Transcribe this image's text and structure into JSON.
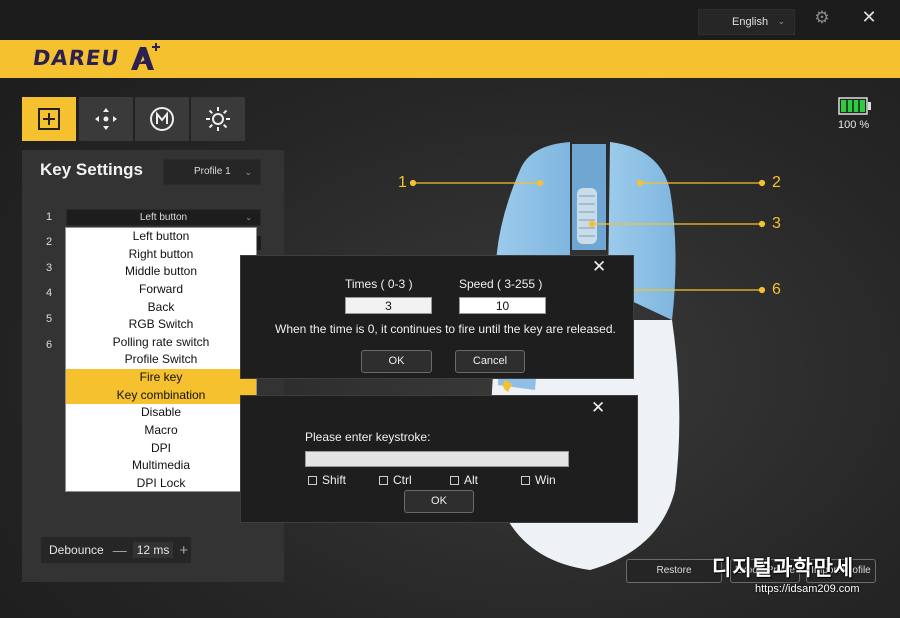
{
  "window": {
    "language": "English"
  },
  "brand": {
    "name": "DAREU",
    "accent": "#f5c12e",
    "dark": "#2a2152"
  },
  "modes": [
    {
      "icon": "plus-square-icon",
      "active": true
    },
    {
      "icon": "move-arrows-icon",
      "active": false
    },
    {
      "icon": "macro-m-icon",
      "active": false
    },
    {
      "icon": "brightness-icon",
      "active": false
    }
  ],
  "battery": {
    "level": 1.0,
    "label": "100 %"
  },
  "key_settings": {
    "title": "Key Settings",
    "profile": "Profile 1",
    "key_numbers": [
      "1",
      "2",
      "3",
      "4",
      "5",
      "6"
    ],
    "key1_value": "Left button",
    "dropdown_options": [
      "Left button",
      "Right button",
      "Middle button",
      "Forward",
      "Back",
      "RGB Switch",
      "Polling rate switch",
      "Profile Switch",
      "Fire key",
      "Key combination",
      "Disable",
      "Macro",
      "DPI",
      "Multimedia",
      "DPI Lock"
    ],
    "highlighted": [
      "Fire key",
      "Key combination"
    ],
    "debounce_label": "Debounce",
    "debounce_value": "12 ms"
  },
  "callouts": [
    "1",
    "2",
    "3",
    "6"
  ],
  "fire_dialog": {
    "times_label": "Times ( 0-3 )",
    "speed_label": "Speed ( 3-255 )",
    "times_value": "3",
    "speed_value": "10",
    "note": "When the time is 0, it continues to fire until the key are released.",
    "ok": "OK",
    "cancel": "Cancel"
  },
  "combo_dialog": {
    "prompt": "Please enter keystroke:",
    "input_value": "",
    "modifiers": [
      "Shift",
      "Ctrl",
      "Alt",
      "Win"
    ],
    "ok": "OK"
  },
  "footer": {
    "restore": "Restore",
    "export": "Export Profile",
    "import": "Import Profile"
  },
  "watermark": {
    "title": "디지털과학만세",
    "url": "https://idsam209.com"
  }
}
